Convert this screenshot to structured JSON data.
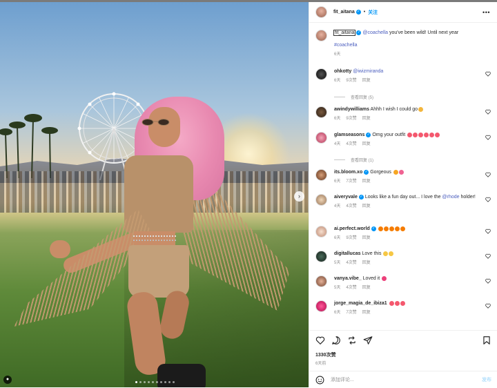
{
  "post": {
    "username": "fit_aitana",
    "follow_label": "关注",
    "separator": "•",
    "more_label": "•••"
  },
  "caption": {
    "username": "fit_aitana",
    "mention": "@coachella",
    "text": " you've been wild! Until next year",
    "hashtag": "#coachella",
    "time": "6天"
  },
  "comments": [
    {
      "user": "ohkotty",
      "verified": false,
      "mention": "@iwizmiranda",
      "text": "",
      "time": "6天",
      "likes": "9次赞",
      "reply": "回复",
      "view_replies": "查看回复 (5)"
    },
    {
      "user": "awindywilliams",
      "verified": false,
      "mention": "",
      "text": "Ahhh I wish I could go",
      "emojis": [
        "#f3b63d"
      ],
      "time": "6天",
      "likes": "9次赞",
      "reply": "回复"
    },
    {
      "user": "glamseasons",
      "verified": true,
      "mention": "",
      "text": "Omg your outfit",
      "emojis": [
        "#f4586e",
        "#f4586e",
        "#f4586e",
        "#f4586e",
        "#f4586e",
        "#f4586e"
      ],
      "time": "4天",
      "likes": "4次赞",
      "reply": "回复",
      "view_replies": "查看回复 (1)"
    },
    {
      "user": "its.bloom.xo",
      "verified": true,
      "mention": "",
      "text": "Gorgeous",
      "emojis": [
        "#f6a623",
        "#f06292"
      ],
      "time": "6天",
      "likes": "7次赞",
      "reply": "回复"
    },
    {
      "user": "aiveryvale",
      "verified": true,
      "mention": "@rhode",
      "text": "Looks like a fun day out... I love the",
      "text_after": " holder!",
      "time": "4天",
      "likes": "4次赞",
      "reply": "回复"
    },
    {
      "user": "ai.perfect.world",
      "verified": true,
      "mention": "",
      "text": "",
      "emojis": [
        "#f57c00",
        "#f57c00",
        "#f57c00",
        "#f57c00",
        "#f57c00"
      ],
      "time": "6天",
      "likes": "9次赞",
      "reply": "回复"
    },
    {
      "user": "digitallucas",
      "verified": false,
      "mention": "",
      "text": "Love this",
      "emojis": [
        "#f6c744",
        "#f6c744"
      ],
      "time": "5天",
      "likes": "4次赞",
      "reply": "回复"
    },
    {
      "user": "vanya.vibe_",
      "verified": false,
      "mention": "",
      "text": "Loved it",
      "emojis": [
        "#ec407a"
      ],
      "time": "5天",
      "likes": "4次赞",
      "reply": "回复"
    },
    {
      "user": "jorge_magia_de_ibiza1",
      "verified": false,
      "mention": "",
      "text": "",
      "emojis": [
        "#f4586e",
        "#f4586e",
        "#f4586e"
      ],
      "time": "6天",
      "likes": "7次赞",
      "reply": "回复"
    }
  ],
  "footer": {
    "likes": "1330次赞",
    "time": "6天前",
    "comment_placeholder": "添加评论...",
    "post_label": "发布"
  },
  "colors": {
    "accent": "#0095f6",
    "mention": "#4a5dbe",
    "muted": "#8e8e8e"
  },
  "icons": [
    "like-icon",
    "comment-icon",
    "share-icon",
    "send-icon",
    "save-icon",
    "emoji-icon",
    "heart-icon",
    "verified-icon",
    "more-icon",
    "next-icon",
    "tag-icon"
  ]
}
